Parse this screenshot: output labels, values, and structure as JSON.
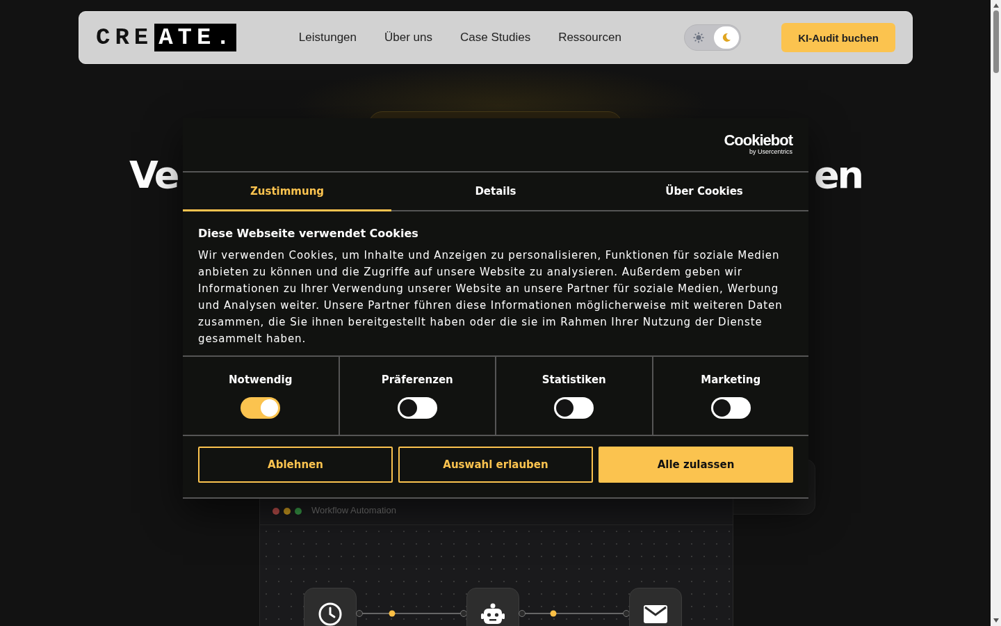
{
  "nav": {
    "logo_plain": "CRE",
    "logo_boxed": "ATE.",
    "links": [
      {
        "label": "Leistungen"
      },
      {
        "label": "Über uns"
      },
      {
        "label": "Case Studies"
      },
      {
        "label": "Ressourcen"
      }
    ],
    "theme_dark": true,
    "cta": "KI-Audit buchen"
  },
  "hero": {
    "heading_left": "Ve",
    "heading_right": "en",
    "window_title": "Workflow Automation"
  },
  "cookie_dialog": {
    "brand": "Cookiebot",
    "brand_sub": "by Usercentrics",
    "tabs": [
      {
        "label": "Zustimmung",
        "selected": true
      },
      {
        "label": "Details",
        "selected": false
      },
      {
        "label": "Über Cookies",
        "selected": false
      }
    ],
    "title": "Diese Webseite verwendet Cookies",
    "text": "Wir verwenden Cookies, um Inhalte und Anzeigen zu personalisieren, Funktionen für soziale Medien anbieten zu können und die Zugriffe auf unsere Website zu analysieren. Außerdem geben wir Informationen zu Ihrer Verwendung unserer Website an unsere Partner für soziale Medien, Werbung und Analysen weiter. Unsere Partner führen diese Informationen möglicherweise mit weiteren Daten zusammen, die Sie ihnen bereitgestellt haben oder die sie im Rahmen Ihrer Nutzung der Dienste gesammelt haben.",
    "categories": [
      {
        "label": "Notwendig",
        "checked": true
      },
      {
        "label": "Präferenzen",
        "checked": false
      },
      {
        "label": "Statistiken",
        "checked": false
      },
      {
        "label": "Marketing",
        "checked": false
      }
    ],
    "buttons": [
      {
        "label": "Ablehnen",
        "kind": "outline"
      },
      {
        "label": "Auswahl erlauben",
        "kind": "outline"
      },
      {
        "label": "Alle zulassen",
        "kind": "filled"
      }
    ]
  }
}
